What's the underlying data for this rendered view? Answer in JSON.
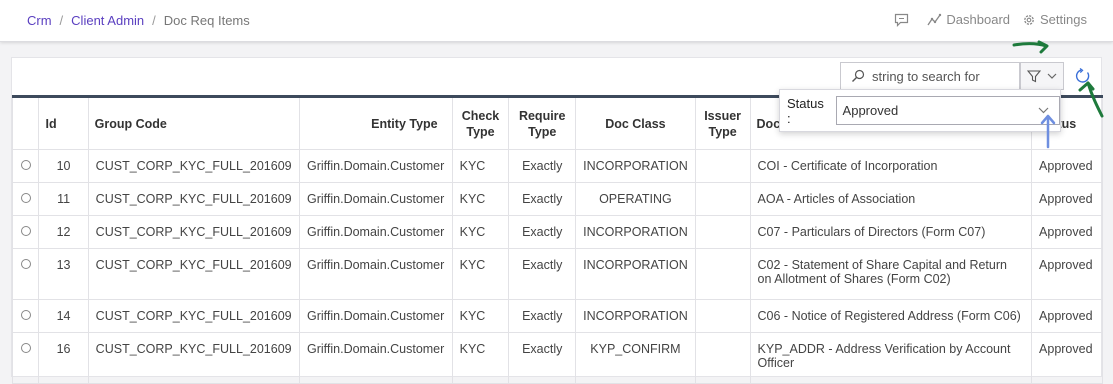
{
  "breadcrumb": {
    "items": [
      "Crm",
      "Client Admin"
    ],
    "current": "Doc Req Items",
    "separator": "/"
  },
  "top_actions": {
    "chat_icon": "chat-icon",
    "dashboard_label": "Dashboard",
    "settings_label": "Settings"
  },
  "toolbar": {
    "search_placeholder": "string to search for"
  },
  "filter_popover": {
    "status_label": "Status :",
    "status_value": "Approved"
  },
  "table": {
    "headers": {
      "id": "Id",
      "group_code": "Group Code",
      "entity_type": "Entity Type",
      "check_type_1": "Check",
      "check_type_2": "Type",
      "require_type_1": "Require",
      "require_type_2": "Type",
      "doc_class": "Doc Class",
      "issuer_type_1": "Issuer",
      "issuer_type_2": "Type",
      "doc_type": "Doc Type",
      "status": "Status"
    },
    "rows": [
      {
        "id": "10",
        "group_code": "CUST_CORP_KYC_FULL_201609",
        "entity_type": "Griffin.Domain.Customer",
        "check_type": "KYC",
        "require_type": "Exactly",
        "doc_class": "INCORPORATION",
        "issuer_type": "",
        "doc_type": "COI - Certificate of Incorporation",
        "status": "Approved"
      },
      {
        "id": "11",
        "group_code": "CUST_CORP_KYC_FULL_201609",
        "entity_type": "Griffin.Domain.Customer",
        "check_type": "KYC",
        "require_type": "Exactly",
        "doc_class": "OPERATING",
        "issuer_type": "",
        "doc_type": "AOA - Articles of Association",
        "status": "Approved"
      },
      {
        "id": "12",
        "group_code": "CUST_CORP_KYC_FULL_201609",
        "entity_type": "Griffin.Domain.Customer",
        "check_type": "KYC",
        "require_type": "Exactly",
        "doc_class": "INCORPORATION",
        "issuer_type": "",
        "doc_type": "C07 - Particulars of Directors (Form C07)",
        "status": "Approved"
      },
      {
        "id": "13",
        "group_code": "CUST_CORP_KYC_FULL_201609",
        "entity_type": "Griffin.Domain.Customer",
        "check_type": "KYC",
        "require_type": "Exactly",
        "doc_class": "INCORPORATION",
        "issuer_type": "",
        "doc_type": "C02 - Statement of Share Capital and Return on Allotment of Shares (Form C02)",
        "status": "Approved"
      },
      {
        "id": "14",
        "group_code": "CUST_CORP_KYC_FULL_201609",
        "entity_type": "Griffin.Domain.Customer",
        "check_type": "KYC",
        "require_type": "Exactly",
        "doc_class": "INCORPORATION",
        "issuer_type": "",
        "doc_type": "C06 - Notice of Registered Address (Form C06)",
        "status": "Approved"
      },
      {
        "id": "16",
        "group_code": "CUST_CORP_KYC_FULL_201609",
        "entity_type": "Griffin.Domain.Customer",
        "check_type": "KYC",
        "require_type": "Exactly",
        "doc_class": "KYP_CONFIRM",
        "issuer_type": "",
        "doc_type": "KYP_ADDR - Address Verification by Account Officer",
        "status": "Approved"
      }
    ]
  },
  "colors": {
    "accent": "#5a3fc0",
    "header_rule": "#3d4a5c",
    "annotation_green": "#1e7a3c",
    "annotation_blue": "#6f8fe0"
  }
}
